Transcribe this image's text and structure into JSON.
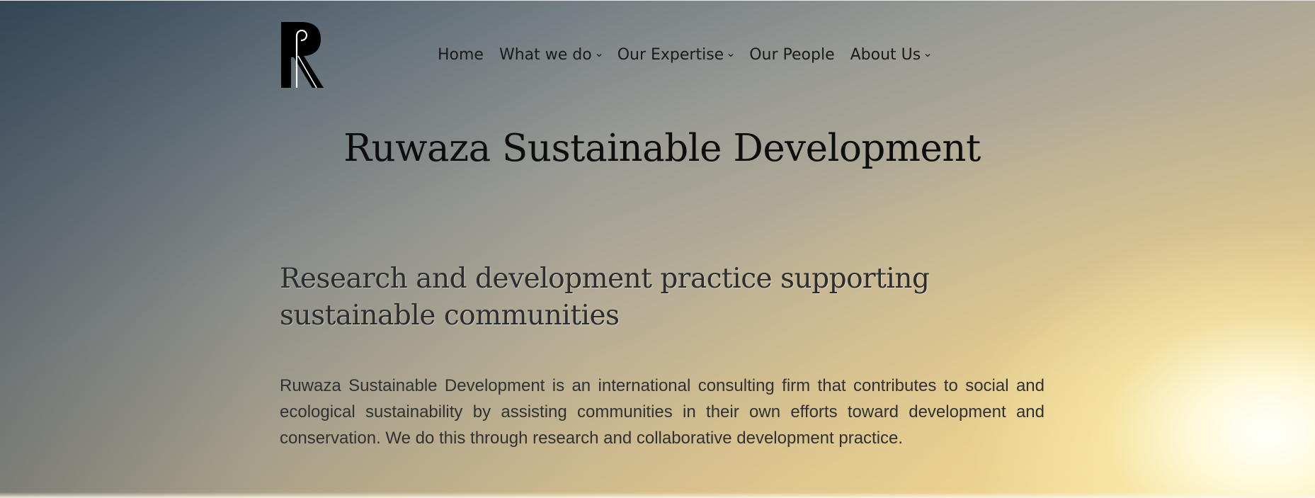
{
  "site": {
    "logo_alt": "R",
    "title": "Ruwaza Sustainable Development"
  },
  "nav": {
    "items": [
      {
        "label": "Home",
        "has_dropdown": false
      },
      {
        "label": "What we do",
        "has_dropdown": true
      },
      {
        "label": "Our Expertise",
        "has_dropdown": true
      },
      {
        "label": "Our People",
        "has_dropdown": false
      },
      {
        "label": "About Us",
        "has_dropdown": true
      }
    ]
  },
  "main": {
    "headline": "Research and development practice supporting sustainable communities",
    "intro": "Ruwaza Sustainable Development is an international consulting firm that contributes to social and ecological sustainability by assisting communities in their own efforts toward development and conservation. We do this through research and collaborative development practice."
  },
  "colors": {
    "text_dark": "#0d0d0d",
    "nav_text": "#1a1a1a",
    "body_text": "#2f3133"
  },
  "icons": {
    "dropdown": "chevron-down-icon"
  }
}
